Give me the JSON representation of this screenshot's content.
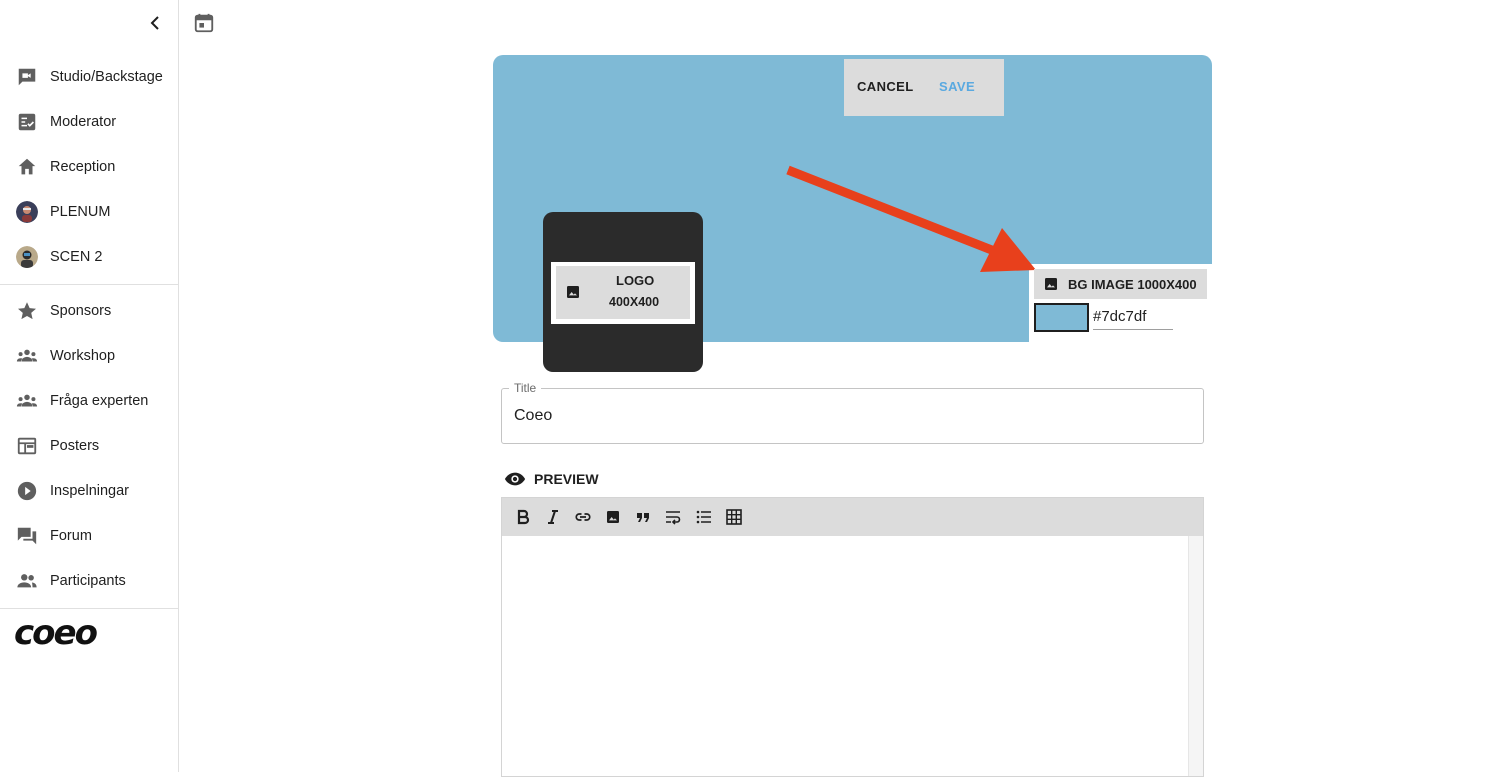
{
  "sidebar": {
    "items": [
      {
        "label": "Studio/Backstage",
        "icon": "video-camera-icon"
      },
      {
        "label": "Moderator",
        "icon": "checklist-icon"
      },
      {
        "label": "Reception",
        "icon": "home-icon"
      },
      {
        "label": "PLENUM",
        "icon": "avatar"
      },
      {
        "label": "SCEN 2",
        "icon": "avatar"
      },
      {
        "label": "Sponsors",
        "icon": "star-icon"
      },
      {
        "label": "Workshop",
        "icon": "groups-icon"
      },
      {
        "label": "Fråga experten",
        "icon": "groups-icon"
      },
      {
        "label": "Posters",
        "icon": "web-layout-icon"
      },
      {
        "label": "Inspelningar",
        "icon": "play-circle-icon"
      },
      {
        "label": "Forum",
        "icon": "forum-icon"
      },
      {
        "label": "Participants",
        "icon": "people-icon"
      }
    ],
    "logo_text": "coeo"
  },
  "banner": {
    "cancel_label": "CANCEL",
    "save_label": "SAVE",
    "logo_button": {
      "line1": "LOGO",
      "line2": "400X400"
    },
    "bg_button_label": "BG IMAGE 1000X400",
    "color_value": "#7dc7df",
    "banner_color": "#7fbad6"
  },
  "form": {
    "title_label": "Title",
    "title_value": "Coeo",
    "preview_label": "PREVIEW"
  },
  "colors": {
    "accent_blue": "#5aa9e0",
    "arrow_red": "#e8401c",
    "logo_card": "#2b2b2b"
  }
}
